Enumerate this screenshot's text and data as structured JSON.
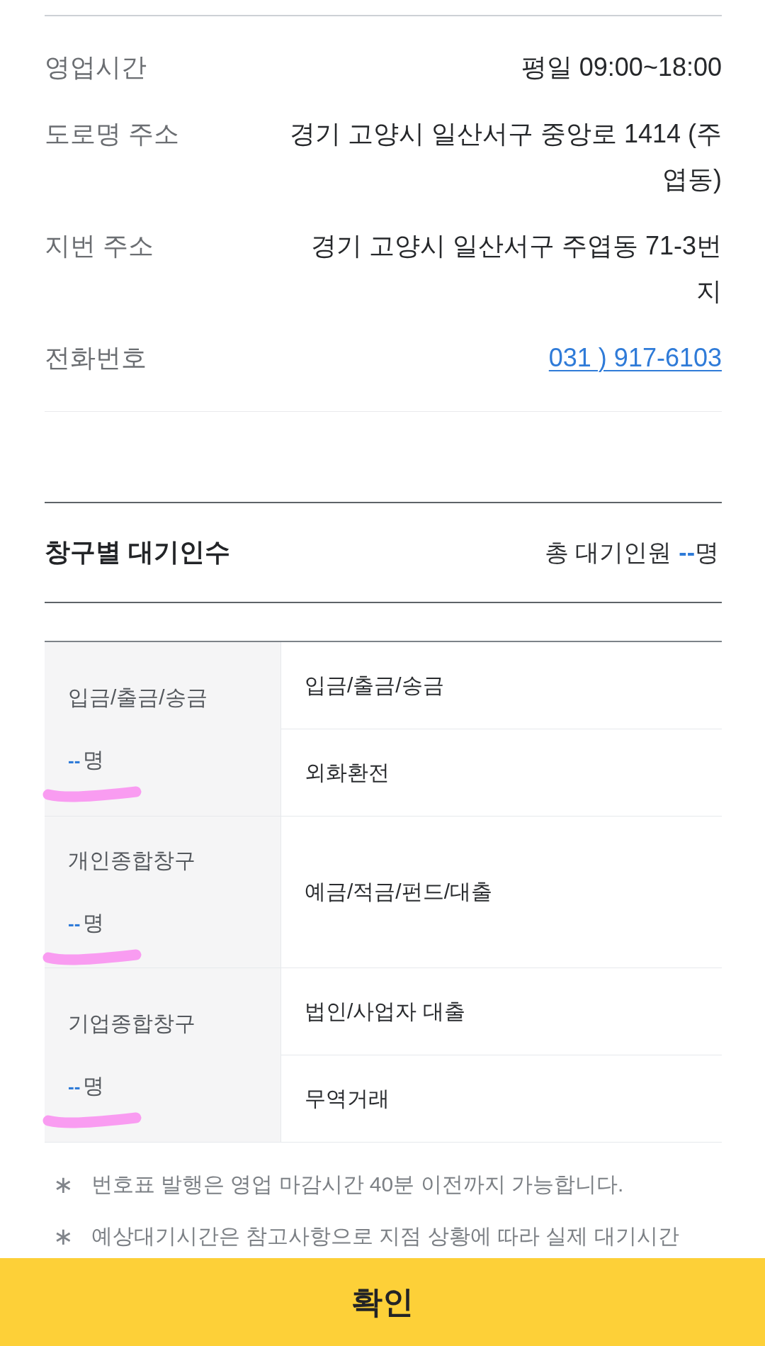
{
  "business_info": [
    {
      "label": "영업시간",
      "value": "평일 09:00~18:00",
      "kind": "text"
    },
    {
      "label": "도로명 주소",
      "value": "경기 고양시 일산서구 중앙로 1414 (주엽동)",
      "kind": "text"
    },
    {
      "label": "지번 주소",
      "value": "경기 고양시 일산서구 주엽동 71-3번지",
      "kind": "text"
    },
    {
      "label": "전화번호",
      "value": "031 ) 917-6103",
      "kind": "link"
    }
  ],
  "waiting": {
    "title": "창구별 대기인수",
    "total_label": "총 대기인원",
    "total_count": "--",
    "total_unit": "명"
  },
  "counters": [
    {
      "name": "입금/출금/송금",
      "count": "--",
      "unit": "명",
      "highlighted": true,
      "services": [
        "입금/출금/송금",
        "외화환전"
      ]
    },
    {
      "name": "개인종합창구",
      "count": "--",
      "unit": "명",
      "highlighted": true,
      "services": [
        "예금/적금/펀드/대출"
      ]
    },
    {
      "name": "기업종합창구",
      "count": "--",
      "unit": "명",
      "highlighted": true,
      "services": [
        "법인/사업자 대출",
        "무역거래"
      ]
    }
  ],
  "notes": [
    {
      "mark": "∗",
      "text": "번호표 발행은 영업 마감시간 40분 이전까지 가능합니다."
    },
    {
      "mark": "∗",
      "text": "예상대기시간은 참고사항으로 지점 상황에 따라 실제 대기시간"
    }
  ],
  "confirm_button": {
    "label": "확인"
  }
}
